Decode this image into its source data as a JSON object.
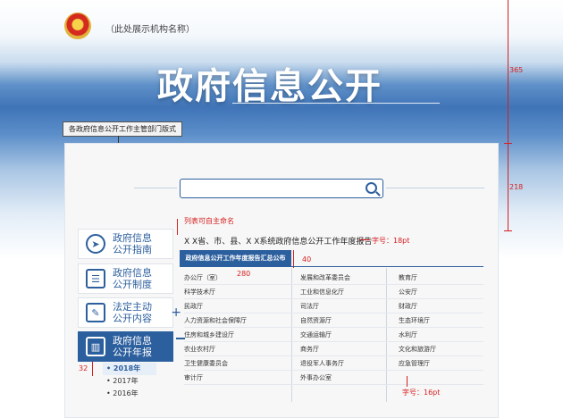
{
  "header": {
    "org_name": "（此处展示机构名称）",
    "title": "政府信息公开",
    "dept_tag": "各政府信息公开工作主管部门版式"
  },
  "sidebar": {
    "items": [
      {
        "label": "政府信息公开指南",
        "icon": "compass-icon",
        "active": false
      },
      {
        "label": "政府信息公开制度",
        "icon": "document-list-icon",
        "active": false
      },
      {
        "label": "法定主动公开内容",
        "icon": "clipboard-icon",
        "active": false,
        "toggle": "+"
      },
      {
        "label": "政府信息公开年报",
        "icon": "bar-chart-icon",
        "active": true,
        "toggle": "−"
      }
    ],
    "years": [
      "• 2018年",
      "• 2017年",
      "• 2016年"
    ]
  },
  "content": {
    "report_title": "X X省、市、县、X X系统政府信息公开工作年度报告",
    "list_header": "政府信息公开工作年度报告汇总公布",
    "departments": [
      "办公厅（室）",
      "发展和改革委员会",
      "教育厅",
      "科学技术厅",
      "工业和信息化厅",
      "公安厅",
      "民政厅",
      "司法厅",
      "财政厅",
      "人力资源和社会保障厅",
      "自然资源厅",
      "生态环境厅",
      "住房和城乡建设厅",
      "交通运输厅",
      "水利厅",
      "农业农村厅",
      "商务厅",
      "文化和旅游厅",
      "卫生健康委员会",
      "退役军人事务厅",
      "应急管理厅",
      "审计厅",
      "外事办公室",
      ""
    ]
  },
  "annotations": {
    "list_custom": "列表可自主命名",
    "font_18": "字号：18pt",
    "font_16": "字号：16pt",
    "width_280": "280",
    "height_40": "40",
    "height_32": "32",
    "ruler_365": "365",
    "ruler_218": "218"
  },
  "colors": {
    "primary": "#2c5f9e",
    "annotation": "#d62020"
  }
}
